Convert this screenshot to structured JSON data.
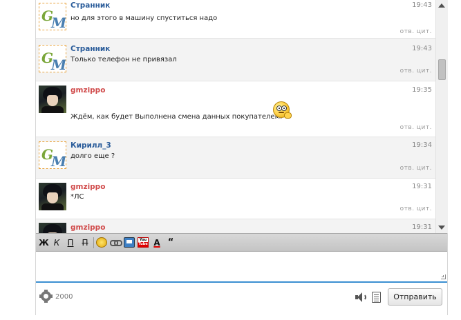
{
  "messages": [
    {
      "author": "Странник",
      "time": "19:43",
      "text": "но для этого в машину спуститься надо",
      "actions": "отв. цит."
    },
    {
      "author": "Странник",
      "time": "19:43",
      "text": "Только телефон не привязал",
      "actions": "отв. цит."
    },
    {
      "author": "gmzippo",
      "time": "19:35",
      "text": "Ждём, как будет Выполнена смена данных покупателем.",
      "actions": "отв. цит."
    },
    {
      "author": "Кирилл_3",
      "time": "19:34",
      "text": "долго еще ?",
      "actions": "отв. цит."
    },
    {
      "author": "gmzippo",
      "time": "19:31",
      "text": "*ЛС",
      "actions": "отв. цит."
    },
    {
      "author": "gmzippo",
      "time": "19:31",
      "text": "",
      "actions": ""
    }
  ],
  "avatar_logo": {
    "letter1": "G",
    "letter2": "M"
  },
  "toolbar": {
    "bold": "Ж",
    "italic": "К",
    "underline": "П",
    "strike": "П",
    "color": "А",
    "quote": "“",
    "youtube_top": "You",
    "youtube_bottom": "Tube"
  },
  "footer": {
    "char_count": "2000",
    "send_label": "Отправить"
  },
  "colors": {
    "author_blue": "#2a5c9a",
    "author_red": "#d04a4a",
    "input_focus": "#3a8fd1"
  },
  "icons": [
    "gear-icon",
    "speaker-icon",
    "notes-icon",
    "smiley-icon",
    "link-icon",
    "image-icon",
    "youtube-icon"
  ]
}
